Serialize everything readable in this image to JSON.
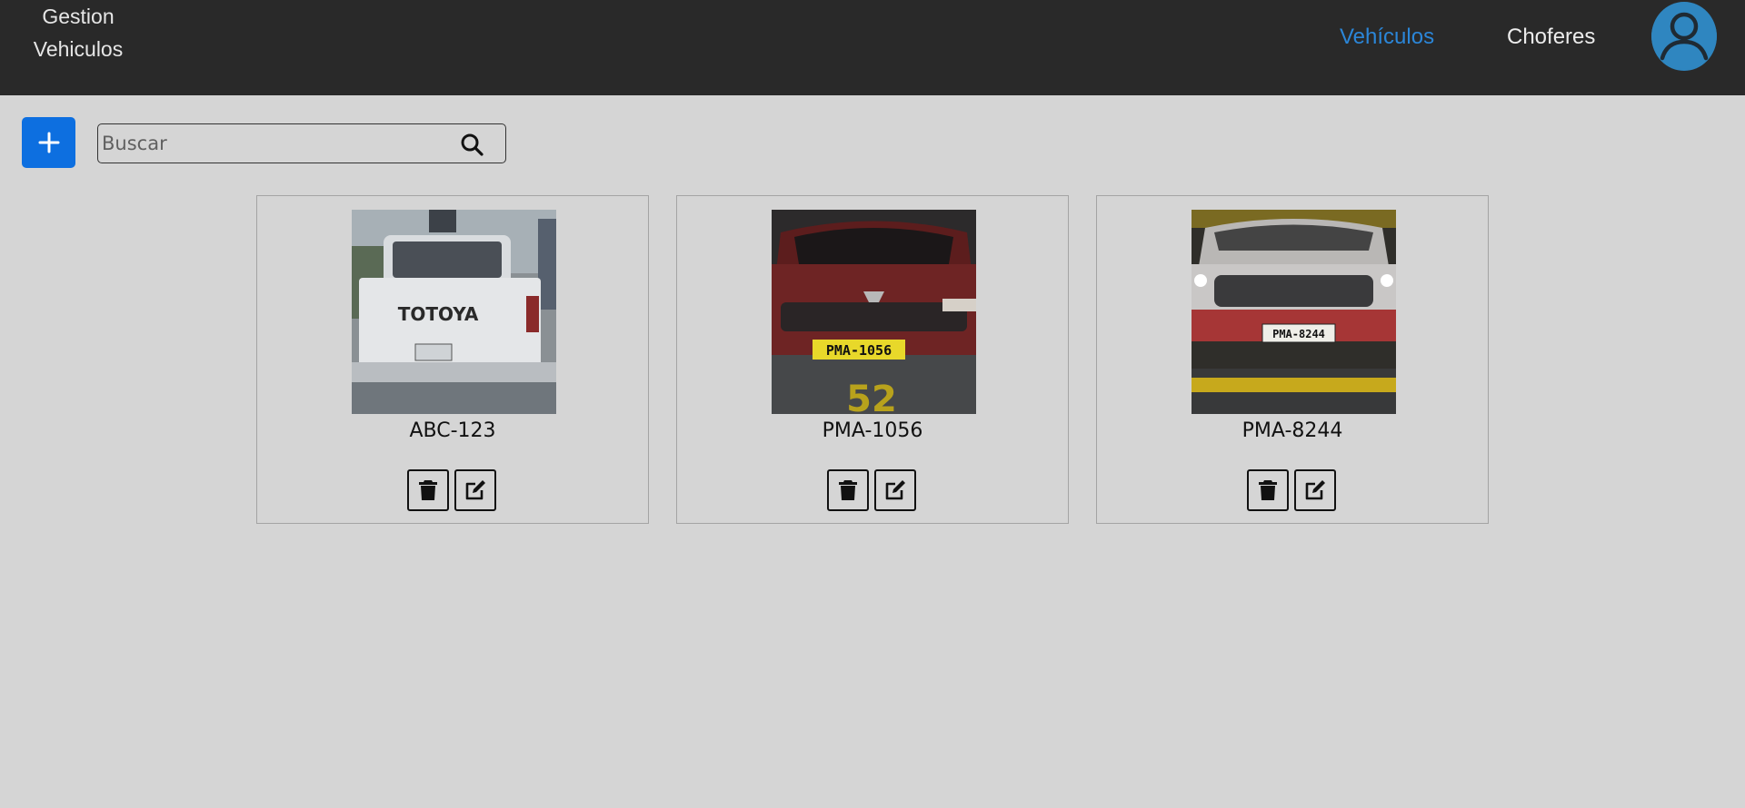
{
  "navbar": {
    "brand_line1": "Gestion",
    "brand_line2": "Vehiculos",
    "links": [
      {
        "label": "Vehículos",
        "active": true,
        "color": "#2b86d8"
      },
      {
        "label": "Choferes",
        "active": false,
        "color": "#ececec"
      }
    ],
    "avatar_icon": "user-avatar-icon"
  },
  "toolbar": {
    "add_label": "+",
    "search": {
      "placeholder": "Buscar",
      "value": "",
      "icon": "search-icon"
    }
  },
  "vehicles": [
    {
      "plate": "ABC-123",
      "photo_text": "TOTOYA",
      "photo": "white pickup truck rear view"
    },
    {
      "plate": "PMA-1056",
      "photo_text": "PMA-1056",
      "photo": "red car front view"
    },
    {
      "plate": "PMA-8244",
      "photo_text": "PMA-8244",
      "photo": "silver car front view"
    }
  ],
  "card_actions": {
    "delete_icon": "trash-icon",
    "edit_icon": "edit-icon"
  },
  "colors": {
    "accent": "#0d6fe0",
    "navbar": "#292929",
    "background": "#d5d5d5",
    "active_link": "#2b86d8"
  }
}
